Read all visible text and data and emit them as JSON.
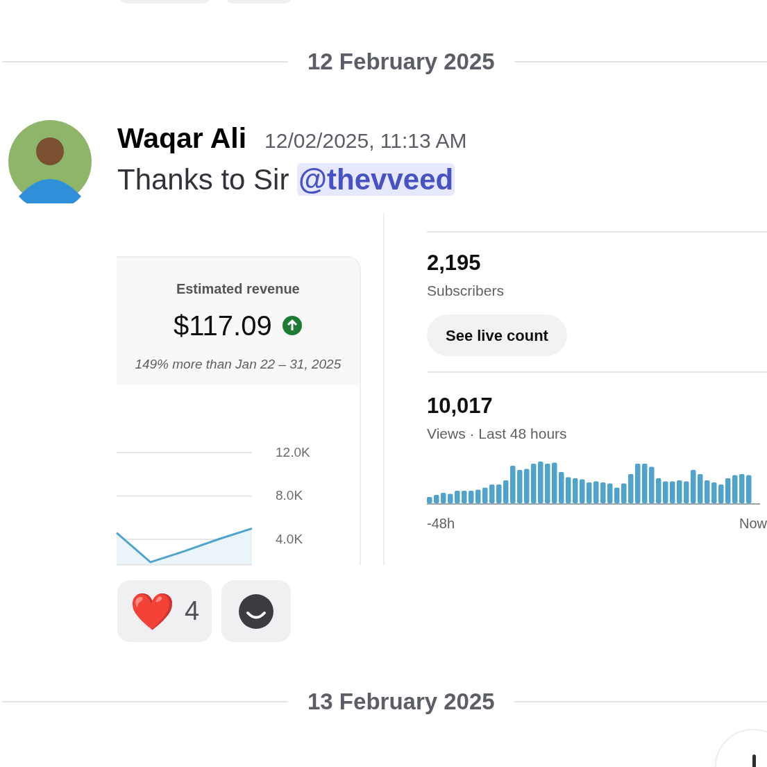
{
  "dividers": [
    "12 February 2025",
    "13 February 2025"
  ],
  "message": {
    "author": "Waqar Ali",
    "timestamp": "12/02/2025, 11:13 AM",
    "text": "Thanks to Sir ",
    "mention": "@thevveed"
  },
  "attachment": {
    "revenue": {
      "label": "Estimated revenue",
      "amount": "$117.09",
      "comparison": "149% more than Jan 22 – 31, 2025",
      "chart_data": {
        "type": "area",
        "categories": [
          null,
          null,
          null,
          null,
          null
        ],
        "values": [
          4600,
          1900,
          2900,
          4000,
          5000
        ],
        "ylim": [
          1600,
          12000
        ],
        "grid": true,
        "yticks": [
          {
            "value": 4000,
            "label": "4.0K"
          },
          {
            "value": 8000,
            "label": "8.0K"
          },
          {
            "value": 12000,
            "label": "12.0K"
          }
        ]
      }
    },
    "subscribers": {
      "count": "2,195",
      "label": "Subscribers",
      "button": "See live count"
    },
    "views": {
      "count": "10,017",
      "label": "Views · Last 48 hours",
      "start_label": "-48h",
      "end_label": "Now"
    }
  },
  "reactions": [
    {
      "emoji": "❤️",
      "count": "4",
      "kind": "emoji"
    },
    {
      "kind": "add"
    }
  ]
}
